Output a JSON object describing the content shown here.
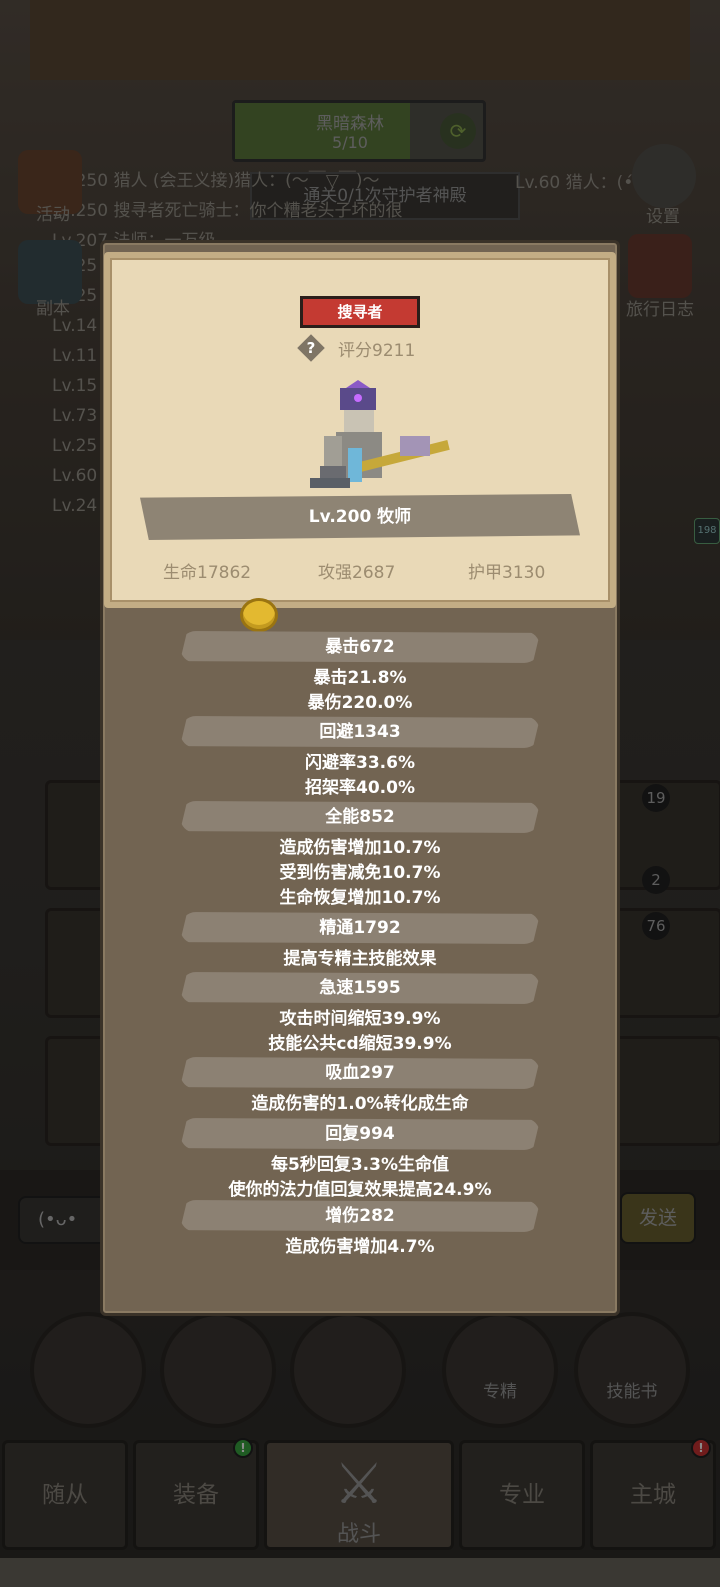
{
  "background": {
    "map_name": "黑暗森林",
    "map_progress": "5/10",
    "quest": "通关0/1次守护者神殿",
    "hunter_text": "Lv.60 猎人：(•́ ▽ •̀ )~",
    "chat_lines": [
      "Lv.250 猎人 (会王义接)猎人：(～￣▽￣)～",
      "Lv.250 搜寻者死亡骑士：你个糟老头子坏的很",
      "Lv.207 法师：一万级",
      "Lv.25",
      "Lv.25",
      "Lv.14",
      "Lv.11",
      "Lv.15",
      "Lv.73",
      "Lv.25",
      "Lv.60",
      "Lv.24"
    ],
    "left_icons": [
      "活动",
      "副本"
    ],
    "right_icons": [
      "设置",
      "旅行日志"
    ],
    "side_badge": "198",
    "grid_badges": [
      "19",
      "2",
      "76"
    ],
    "chat_input": "(•ᴗ•",
    "send_label": "发送",
    "round_buttons": [
      "",
      "",
      "",
      "专精",
      "技能书"
    ],
    "tabs": [
      "随从",
      "装备",
      "战斗",
      "专业",
      "主城"
    ]
  },
  "card": {
    "role": "搜寻者",
    "score_icon": "?",
    "score": "评分9211",
    "level_class": "Lv.200 牧师",
    "hp": "生命17862",
    "attack": "攻强2687",
    "armor": "护甲3130"
  },
  "sections": [
    {
      "title": "暴击672",
      "lines": [
        "暴击21.8%",
        "暴伤220.0%"
      ]
    },
    {
      "title": "回避1343",
      "lines": [
        "闪避率33.6%",
        "招架率40.0%"
      ]
    },
    {
      "title": "全能852",
      "lines": [
        "造成伤害增加10.7%",
        "受到伤害减免10.7%",
        "生命恢复增加10.7%"
      ]
    },
    {
      "title": "精通1792",
      "lines": [
        "提高专精主技能效果"
      ]
    },
    {
      "title": "急速1595",
      "lines": [
        "攻击时间缩短39.9%",
        "技能公共cd缩短39.9%"
      ]
    },
    {
      "title": "吸血297",
      "lines": [
        "造成伤害的1.0%转化成生命"
      ]
    },
    {
      "title": "回复994",
      "lines": [
        "每5秒回复3.3%生命值",
        "使你的法力值回复效果提高24.9%"
      ]
    },
    {
      "title": "增伤282",
      "lines": [
        "造成伤害增加4.7%"
      ]
    }
  ],
  "colors": {
    "role_tag": "#c43a32",
    "card_bg": "#e9d9b7",
    "modal_bg": "#726452",
    "coin": "#e3b930"
  }
}
